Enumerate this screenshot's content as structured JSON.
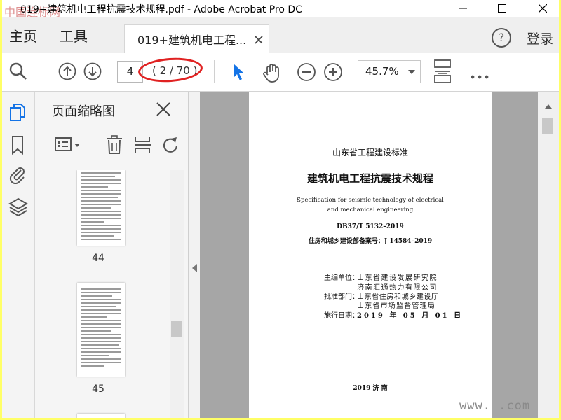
{
  "window": {
    "title": "019+建筑机电工程抗震技术规程.pdf - Adobe Acrobat Pro DC",
    "watermark_top": "中国连标网",
    "controls": [
      "minimize-icon",
      "maximize-icon",
      "close-icon"
    ]
  },
  "menubar": {
    "home_label": "主页",
    "tools_label": "工具",
    "tab_label": "019+建筑机电工程...",
    "help_label": "?",
    "login_label": "登录"
  },
  "toolbar": {
    "page_input_value": "4",
    "page_count": "( 2 / 70 )",
    "zoom_value": "45.7%",
    "icons": [
      "search-icon",
      "prev-page-icon",
      "next-page-icon",
      "select-arrow-icon",
      "hand-icon",
      "zoom-out-icon",
      "zoom-in-icon",
      "fit-page-icon",
      "more-icon"
    ],
    "highlight_color": "#e02222"
  },
  "left_rail": {
    "icons": [
      "page-thumbnails-icon",
      "bookmark-icon",
      "attachment-icon",
      "layers-icon"
    ],
    "active_color": "#1473e6"
  },
  "thumbnails_panel": {
    "title": "页面缩略图",
    "tool_icons": [
      "thumbnail-options-icon",
      "delete-icon",
      "insert-page-icon",
      "rotate-icon"
    ],
    "pages": [
      {
        "number": "44"
      },
      {
        "number": "45"
      }
    ]
  },
  "document_page": {
    "org_title": "山东省工程建设标准",
    "main_title": "建筑机电工程抗震技术规程",
    "english_line1": "Specification for seismic technology of electrical",
    "english_line2": "and mechanical engineering",
    "code": "DB37/T  5132–2019",
    "record_no": "住房和城乡建设部备案号：J 14584–2019",
    "editor_label": "主编单位：",
    "editor_1": "山东省建设发展研究院",
    "editor_2": "济南汇通热力有限公司",
    "approver_label": "批准部门：",
    "approver_1": "山东省住房和城乡建设厅",
    "approver_2": "山东省市场监督管理局",
    "date_label": "施行日期：",
    "date_value": "2019 年 05 月 01 日",
    "footer": "2019  济  南"
  },
  "watermark_bottom": "www.          .com"
}
